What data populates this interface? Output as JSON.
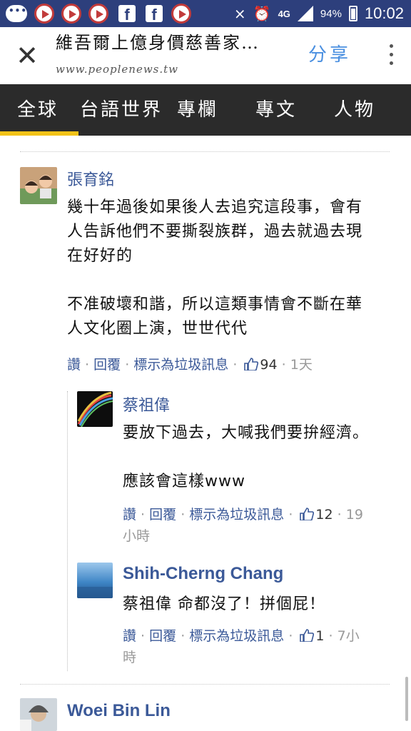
{
  "status_bar": {
    "battery": "94%",
    "network": "4G",
    "time": "10:02"
  },
  "header": {
    "title": "維吾爾上億身價慈善家…",
    "url": "www.peoplenews.tw",
    "share_label": "分享"
  },
  "tabs": [
    "全球",
    "台語世界",
    "專欄",
    "專文",
    "人物"
  ],
  "actions": {
    "like": "讚",
    "reply": "回覆",
    "report": "標示為垃圾訊息"
  },
  "comments": [
    {
      "author": "張育銘",
      "text": "幾十年過後如果後人去追究這段事，會有\n人告訴他們不要撕裂族群，過去就過去現\n在好好的\n\n不准破壞和諧，所以這類事情會不斷在華\n人文化圈上演，世世代代",
      "likes": "94",
      "time": "1天",
      "replies": [
        {
          "author": "蔡祖偉",
          "text": "要放下過去，大喊我們要拚經濟。\n\n應該會這樣www",
          "likes": "12",
          "time_part1": "19",
          "time_part2": "小時"
        },
        {
          "author": "Shih-Cherng Chang",
          "text": "蔡祖偉 命都沒了！拼個屁！",
          "likes": "1",
          "time_part1": "7小",
          "time_part2": "時"
        }
      ]
    },
    {
      "author": "Woei Bin Lin"
    }
  ],
  "colors": {
    "status_bar": "#2d3f7c",
    "tab_bar": "#2b2b2b",
    "tab_indicator": "#f2c318",
    "link_blue": "#3b5998",
    "share_blue": "#4a8fe0"
  }
}
